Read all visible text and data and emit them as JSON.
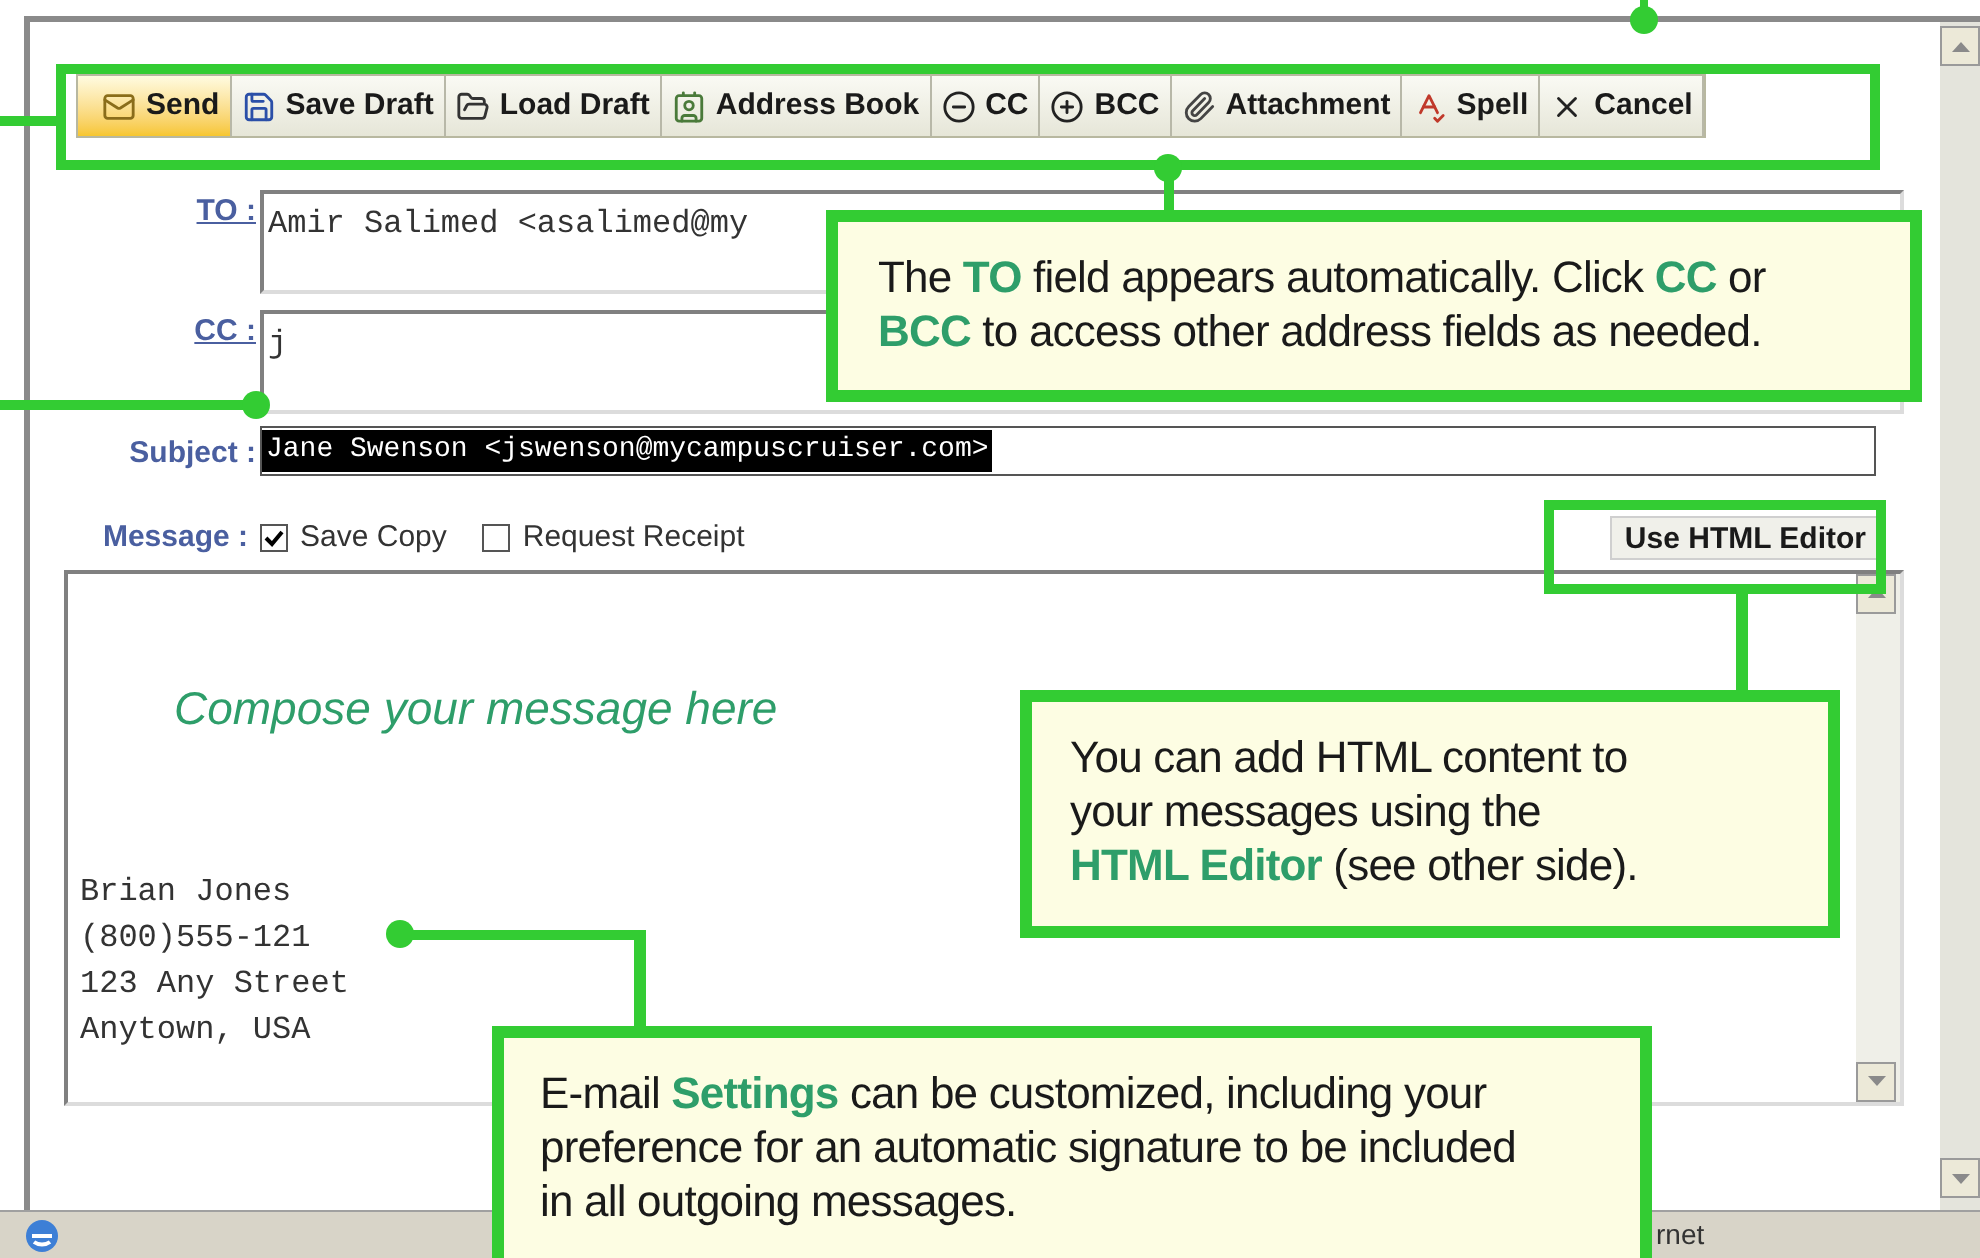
{
  "toolbar": [
    {
      "label": "Send",
      "highlighted": true
    },
    {
      "label": "Save Draft",
      "highlighted": false
    },
    {
      "label": "Load Draft",
      "highlighted": false
    },
    {
      "label": "Address Book",
      "highlighted": false
    },
    {
      "label": "CC",
      "highlighted": false
    },
    {
      "label": "BCC",
      "highlighted": false
    },
    {
      "label": "Attachment",
      "highlighted": false
    },
    {
      "label": "Spell",
      "highlighted": false
    },
    {
      "label": "Cancel",
      "highlighted": false
    }
  ],
  "fields": [
    {
      "label": "TO :",
      "value": "Amir Salimed <asalimed@my"
    },
    {
      "label": "CC :",
      "value": "j"
    }
  ],
  "subject": {
    "label": "Subject :",
    "suggestion": "Jane Swenson <jswenson@mycampuscruiser.com>",
    "selected": true
  },
  "message": {
    "label": "Message :",
    "options": [
      {
        "label": "Save Copy",
        "checked": true
      },
      {
        "label": "Request Receipt",
        "checked": false
      }
    ],
    "html_button": "Use HTML Editor",
    "hint": "Compose your message here",
    "signature": [
      "Brian Jones",
      "(800)555-121",
      "123 Any Street",
      "Anytown, USA"
    ]
  },
  "status_bar": {
    "text": "rnet"
  },
  "callouts": [
    {
      "text": "The **TO** field appears automatically.  Click **CC** or **BCC** to access other address fields as needed."
    },
    {
      "text": "You can add HTML content to your messages using the **HTML Editor** (see other side)."
    },
    {
      "text": "E-mail **Settings** can be customized, including your preference for an automatic signature to be included in all outgoing messages."
    }
  ]
}
